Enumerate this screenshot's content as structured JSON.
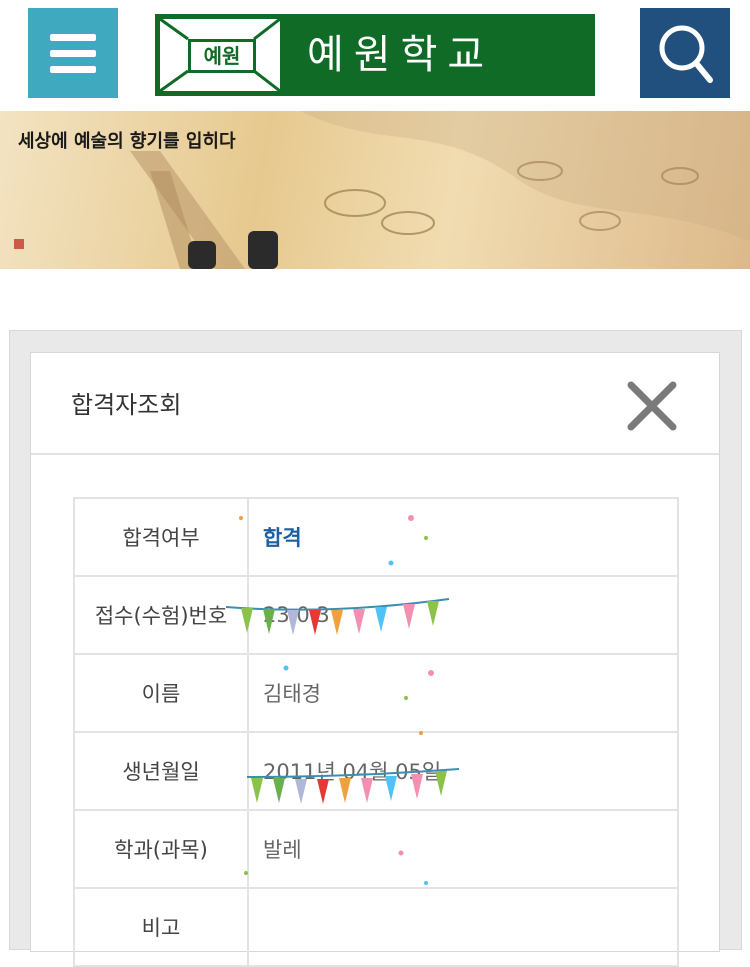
{
  "header": {
    "menu_icon": "hamburger-menu-icon",
    "logo": {
      "emblem_text": "예원",
      "name": "예원학교"
    },
    "search_icon": "search-icon",
    "colors": {
      "menu": "#3ea9bf",
      "logo": "#0f6b26",
      "search": "#21507e"
    }
  },
  "banner": {
    "tagline": "세상에 예술의 향기를 입히다"
  },
  "modal": {
    "title": "합격자조회",
    "close_icon": "close-icon",
    "rows": [
      {
        "label": "합격여부",
        "value": "합격"
      },
      {
        "label": "접수(수험)번호",
        "value": "23 0 3"
      },
      {
        "label": "이름",
        "value": "김태경"
      },
      {
        "label": "생년월일",
        "value": "2011년 04월 05일"
      },
      {
        "label": "학과(과목)",
        "value": "발레"
      },
      {
        "label": "비고",
        "value": ""
      }
    ],
    "colors": {
      "pass": "#1d5fa0"
    }
  }
}
